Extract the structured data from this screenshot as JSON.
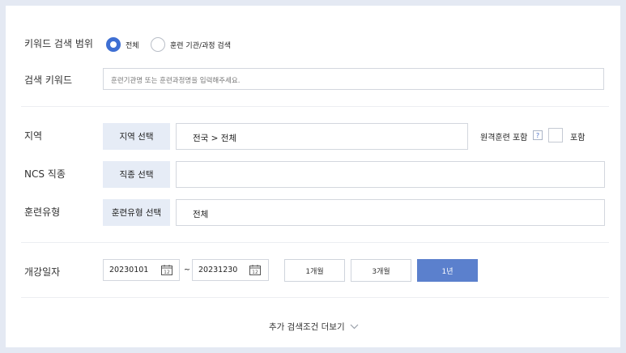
{
  "keyword_scope": {
    "label": "키워드 검색 범위",
    "options": [
      {
        "label": "전체",
        "selected": true
      },
      {
        "label": "훈련 기관/과정 검색",
        "selected": false
      }
    ]
  },
  "search_keyword": {
    "label": "검색 키워드",
    "placeholder": "훈련기관명 또는 훈련과정명을 입력해주세요."
  },
  "region": {
    "label": "지역",
    "select_button": "지역 선택",
    "value": "전국 > 전체",
    "remote_label": "원격훈련 포함",
    "help_icon": "?",
    "include_label": "포함",
    "include_checked": false
  },
  "ncs": {
    "label": "NCS 직종",
    "select_button": "직종 선택",
    "value": ""
  },
  "training_type": {
    "label": "훈련유형",
    "select_button": "훈련유형 선택",
    "value": "전체"
  },
  "start_date": {
    "label": "개강일자",
    "from": "20230101",
    "to": "20231230",
    "tilde": "~",
    "calendar_icon_text": "12",
    "periods": [
      {
        "label": "1개월",
        "active": false
      },
      {
        "label": "3개월",
        "active": false
      },
      {
        "label": "1년",
        "active": true
      }
    ]
  },
  "more": {
    "label": "추가 검색조건 더보기",
    "icon": "chevron-down-icon"
  },
  "colors": {
    "accent": "#3e6fd3",
    "active_button": "#5b80cd",
    "select_button_bg": "#e6ecf6",
    "frame_border": "#e4e9f3"
  }
}
